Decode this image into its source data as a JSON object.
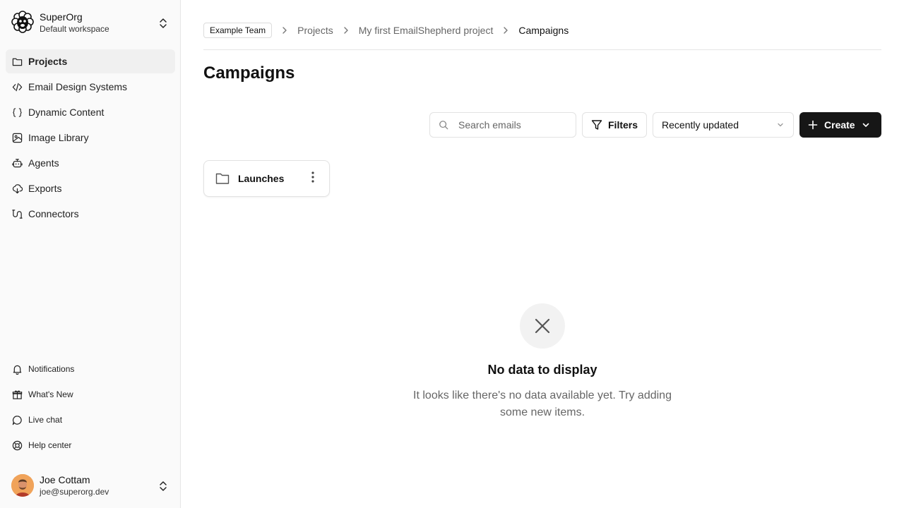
{
  "org": {
    "name": "SuperOrg",
    "workspace": "Default workspace"
  },
  "nav": {
    "items": [
      {
        "label": "Projects",
        "icon": "folder-icon",
        "active": true
      },
      {
        "label": "Email Design Systems",
        "icon": "code-icon",
        "active": false
      },
      {
        "label": "Dynamic Content",
        "icon": "braces-icon",
        "active": false
      },
      {
        "label": "Image Library",
        "icon": "image-icon",
        "active": false
      },
      {
        "label": "Agents",
        "icon": "bot-icon",
        "active": false
      },
      {
        "label": "Exports",
        "icon": "cloud-download-icon",
        "active": false
      },
      {
        "label": "Connectors",
        "icon": "connector-icon",
        "active": false
      }
    ]
  },
  "footer_nav": {
    "items": [
      {
        "label": "Notifications",
        "icon": "bell-icon"
      },
      {
        "label": "What's New",
        "icon": "gift-icon"
      },
      {
        "label": "Live chat",
        "icon": "chat-icon"
      },
      {
        "label": "Help center",
        "icon": "lifebuoy-icon"
      }
    ]
  },
  "user": {
    "name": "Joe Cottam",
    "email": "joe@superorg.dev"
  },
  "breadcrumb": {
    "team": "Example Team",
    "items": [
      "Projects",
      "My first EmailShepherd project",
      "Campaigns"
    ]
  },
  "page": {
    "title": "Campaigns"
  },
  "toolbar": {
    "search_placeholder": "Search emails",
    "filters_label": "Filters",
    "sort_value": "Recently updated",
    "create_label": "Create"
  },
  "folders": [
    {
      "name": "Launches"
    }
  ],
  "empty_state": {
    "title": "No data to display",
    "description": "It looks like there's no data available yet. Try adding some new items."
  },
  "colors": {
    "primary_button": "#161616",
    "sidebar_bg": "#fafafa",
    "active_item_bg": "#f0f0f0"
  }
}
